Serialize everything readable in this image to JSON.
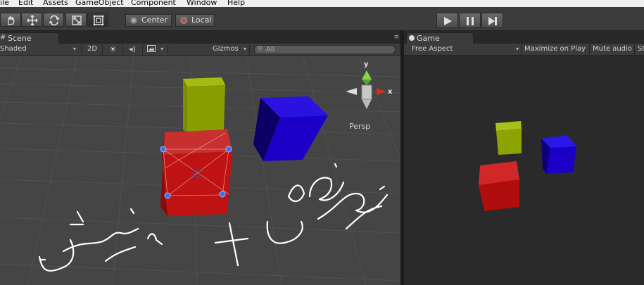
{
  "menu": [
    "ile",
    "Edit",
    "Assets",
    "GameObject",
    "Component",
    "Window",
    "Help"
  ],
  "toolbar": {
    "tools": [
      "hand-tool-icon",
      "move-tool-icon",
      "rotate-tool-icon",
      "scale-tool-icon",
      "rect-tool-icon"
    ],
    "pivot_label": "Center",
    "space_label": "Local"
  },
  "scene": {
    "tab_label": "Scene",
    "shading_mode": "Shaded",
    "mode_2d_label": "2D",
    "gizmos_label": "Gizmos",
    "search_placeholder": "All",
    "persp_label": "Persp",
    "axis_y_label": "y",
    "axis_x_label": "x"
  },
  "game": {
    "tab_label": "Game",
    "aspect_label": "Free Aspect",
    "maximize_label": "Maximize on Play",
    "mute_label": "Mute audio",
    "stats_label": "St"
  },
  "colors": {
    "cube_red": "#c41414",
    "cube_yellow": "#8aa000",
    "cube_blue": "#1c00c8",
    "scene_bg": "#454545",
    "game_bg": "#2a2a2a"
  }
}
